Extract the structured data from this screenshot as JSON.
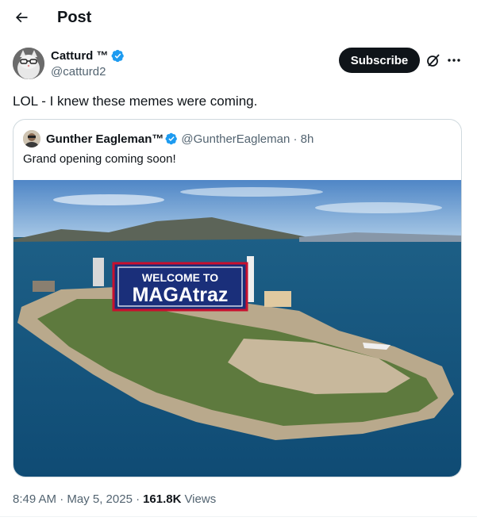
{
  "header": {
    "title": "Post"
  },
  "post": {
    "author_name": "Catturd ™",
    "author_handle": "@catturd2",
    "subscribe_label": "Subscribe",
    "text": "LOL - I knew these memes were coming.",
    "timestamp": "8:49 AM · May 5, 2025 ·",
    "views_count": "161.8K",
    "views_label": "Views"
  },
  "quote": {
    "author_name": "Gunther Eagleman™",
    "author_handle": "@GuntherEagleman · 8h",
    "text": "Grand opening coming soon!",
    "image_sign_line1": "WELCOME TO",
    "image_sign_line2": "MAGAtraz"
  },
  "colors": {
    "verified": "#1d9bf0",
    "text": "#0f1419",
    "muted": "#536471",
    "border": "#cfd9de"
  },
  "icons": [
    "back-arrow-icon",
    "verified-badge-icon",
    "grok-icon",
    "more-icon"
  ]
}
